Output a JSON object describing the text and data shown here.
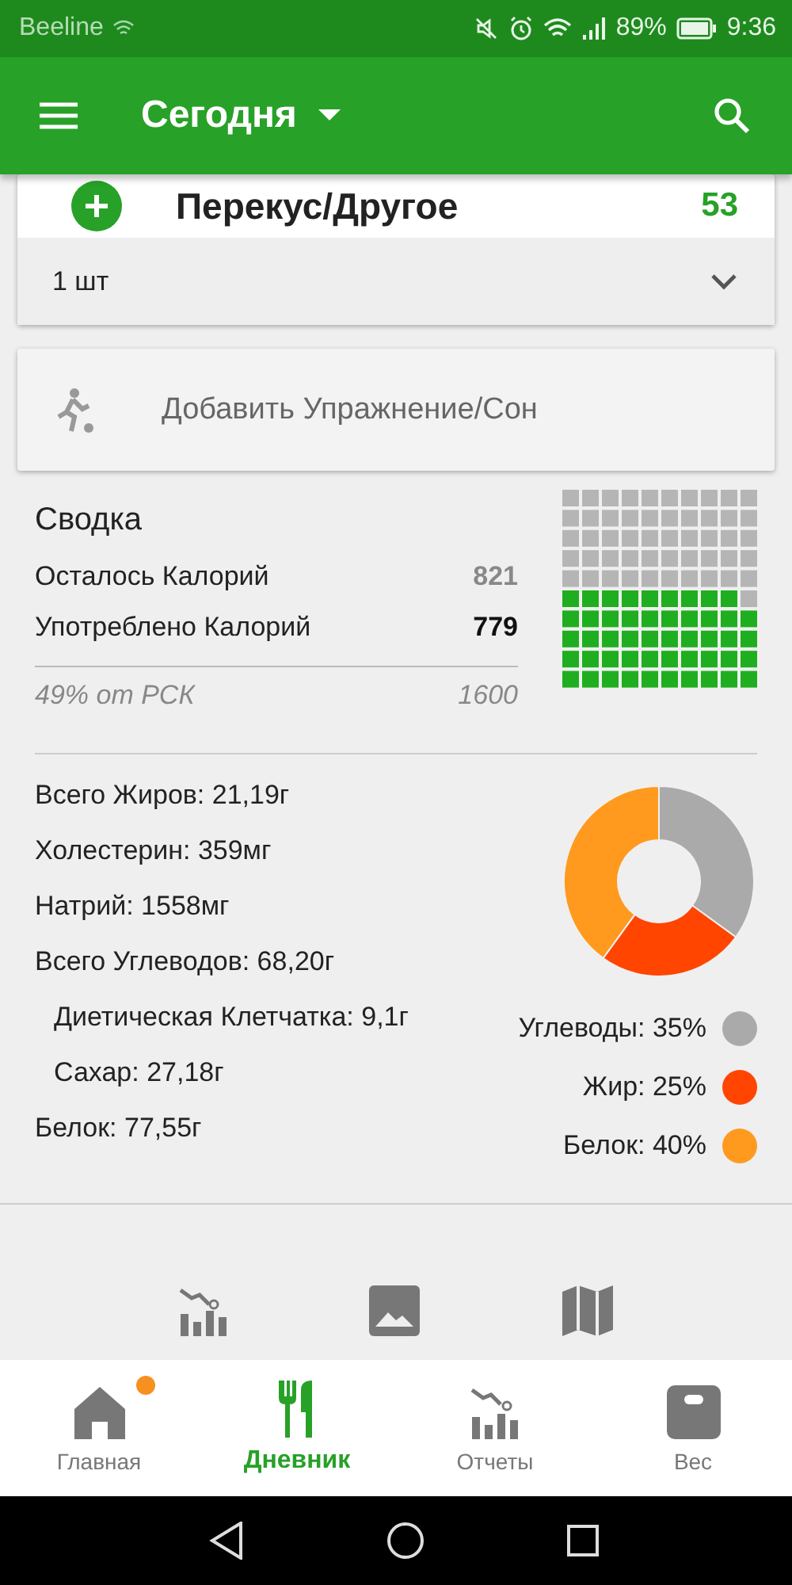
{
  "status_bar": {
    "carrier": "Beeline",
    "battery": "89%",
    "time": "9:36"
  },
  "app_bar": {
    "title": "Сегодня"
  },
  "meal": {
    "name": "Перекус/Другое",
    "calories": "53",
    "serving": "1 шт"
  },
  "add_exercise": {
    "label": "Добавить Упражнение/Сон"
  },
  "summary": {
    "title": "Сводка",
    "rows": [
      {
        "label": "Осталось Калорий",
        "value": "821",
        "kind": "remaining"
      },
      {
        "label": "Употреблено Калорий",
        "value": "779",
        "kind": "consumed"
      }
    ],
    "footer_label": "49% от РСК",
    "footer_value": "1600",
    "level": 0.49
  },
  "nutrients": [
    {
      "text": "Всего Жиров: 21,19г",
      "kind": "main"
    },
    {
      "text": "Холестерин: 359мг",
      "kind": "main"
    },
    {
      "text": "Натрий: 1558мг",
      "kind": "main"
    },
    {
      "text": "Всего Углеводов: 68,20г",
      "kind": "main"
    },
    {
      "text": "Диетическая Клетчатка: 9,1г",
      "kind": "sub"
    },
    {
      "text": "Сахар: 27,18г",
      "kind": "sub"
    },
    {
      "text": "Белок: 77,55г",
      "kind": "main"
    }
  ],
  "macros": {
    "chart_data": {
      "type": "donut",
      "categories": [
        "Углеводы: 35%",
        "Жир: 25%",
        "Белок: 40%"
      ],
      "series": [
        {
          "values": [
            35,
            25,
            40
          ]
        }
      ]
    },
    "legend": [
      {
        "color": "#aaaaaa"
      },
      {
        "color": "#ff4500"
      },
      {
        "color": "#ff9a1f"
      }
    ]
  },
  "bottom_nav": [
    {
      "label": "Главная",
      "selected": false,
      "badge": true,
      "kind": "home"
    },
    {
      "label": "Дневник",
      "selected": true,
      "badge": false,
      "kind": "diary"
    },
    {
      "label": "Отчеты",
      "selected": false,
      "badge": false,
      "kind": "reports"
    },
    {
      "label": "Вес",
      "selected": false,
      "badge": false,
      "kind": "weight"
    }
  ]
}
